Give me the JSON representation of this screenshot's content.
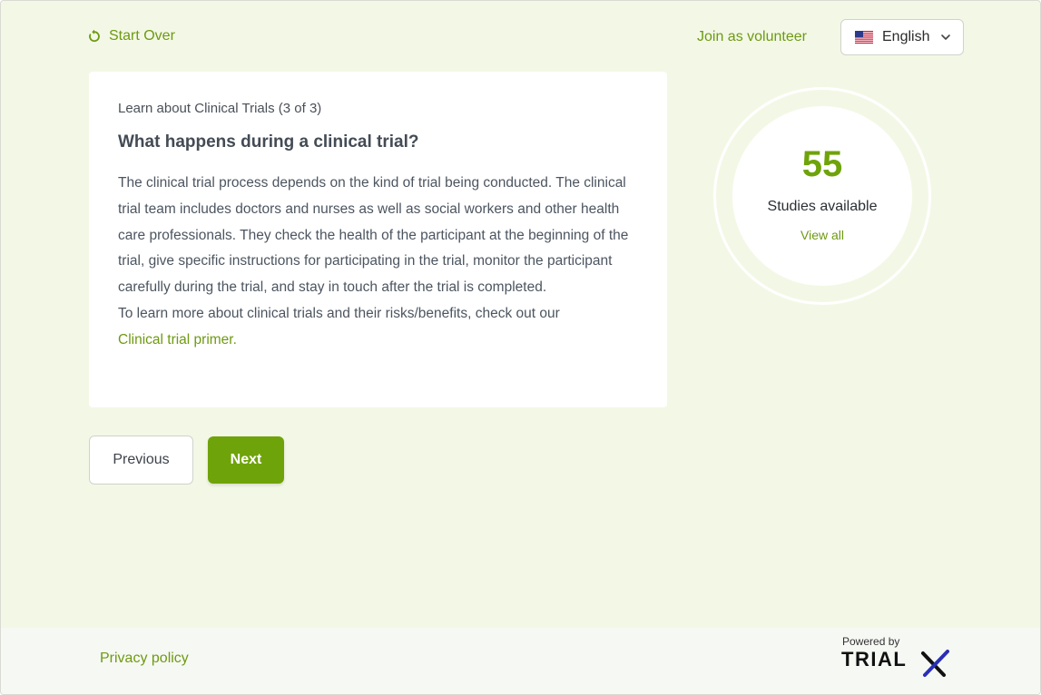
{
  "header": {
    "start_over_label": "Start Over",
    "join_label": "Join as volunteer",
    "language": {
      "selected": "English",
      "flag": "us-flag-icon"
    }
  },
  "card": {
    "step": "Learn about Clinical Trials (3 of 3)",
    "title": "What happens during a clinical trial?",
    "paragraph": "The clinical trial process depends on the kind of trial being conducted. The clinical trial team includes doctors and nurses as well as social workers and other health care professionals. They check the health of the participant at the beginning of the trial, give specific instructions for participating in the trial, monitor the participant carefully during the trial, and stay in touch after the trial is completed.",
    "learn_more": "To learn more about clinical trials and their risks/benefits, check out our",
    "primer_link": "Clinical trial primer",
    "primer_suffix": "."
  },
  "nav": {
    "previous_label": "Previous",
    "next_label": "Next"
  },
  "studies": {
    "count": "55",
    "label": "Studies available",
    "view_all": "View all"
  },
  "footer": {
    "privacy_label": "Privacy policy",
    "powered_by": "Powered by",
    "brand_text": "TRIALX"
  },
  "colors": {
    "accent": "#6fa30a",
    "link": "#6e9a12",
    "background": "#f3f8e6",
    "brand_x": "#2a2fb8"
  }
}
